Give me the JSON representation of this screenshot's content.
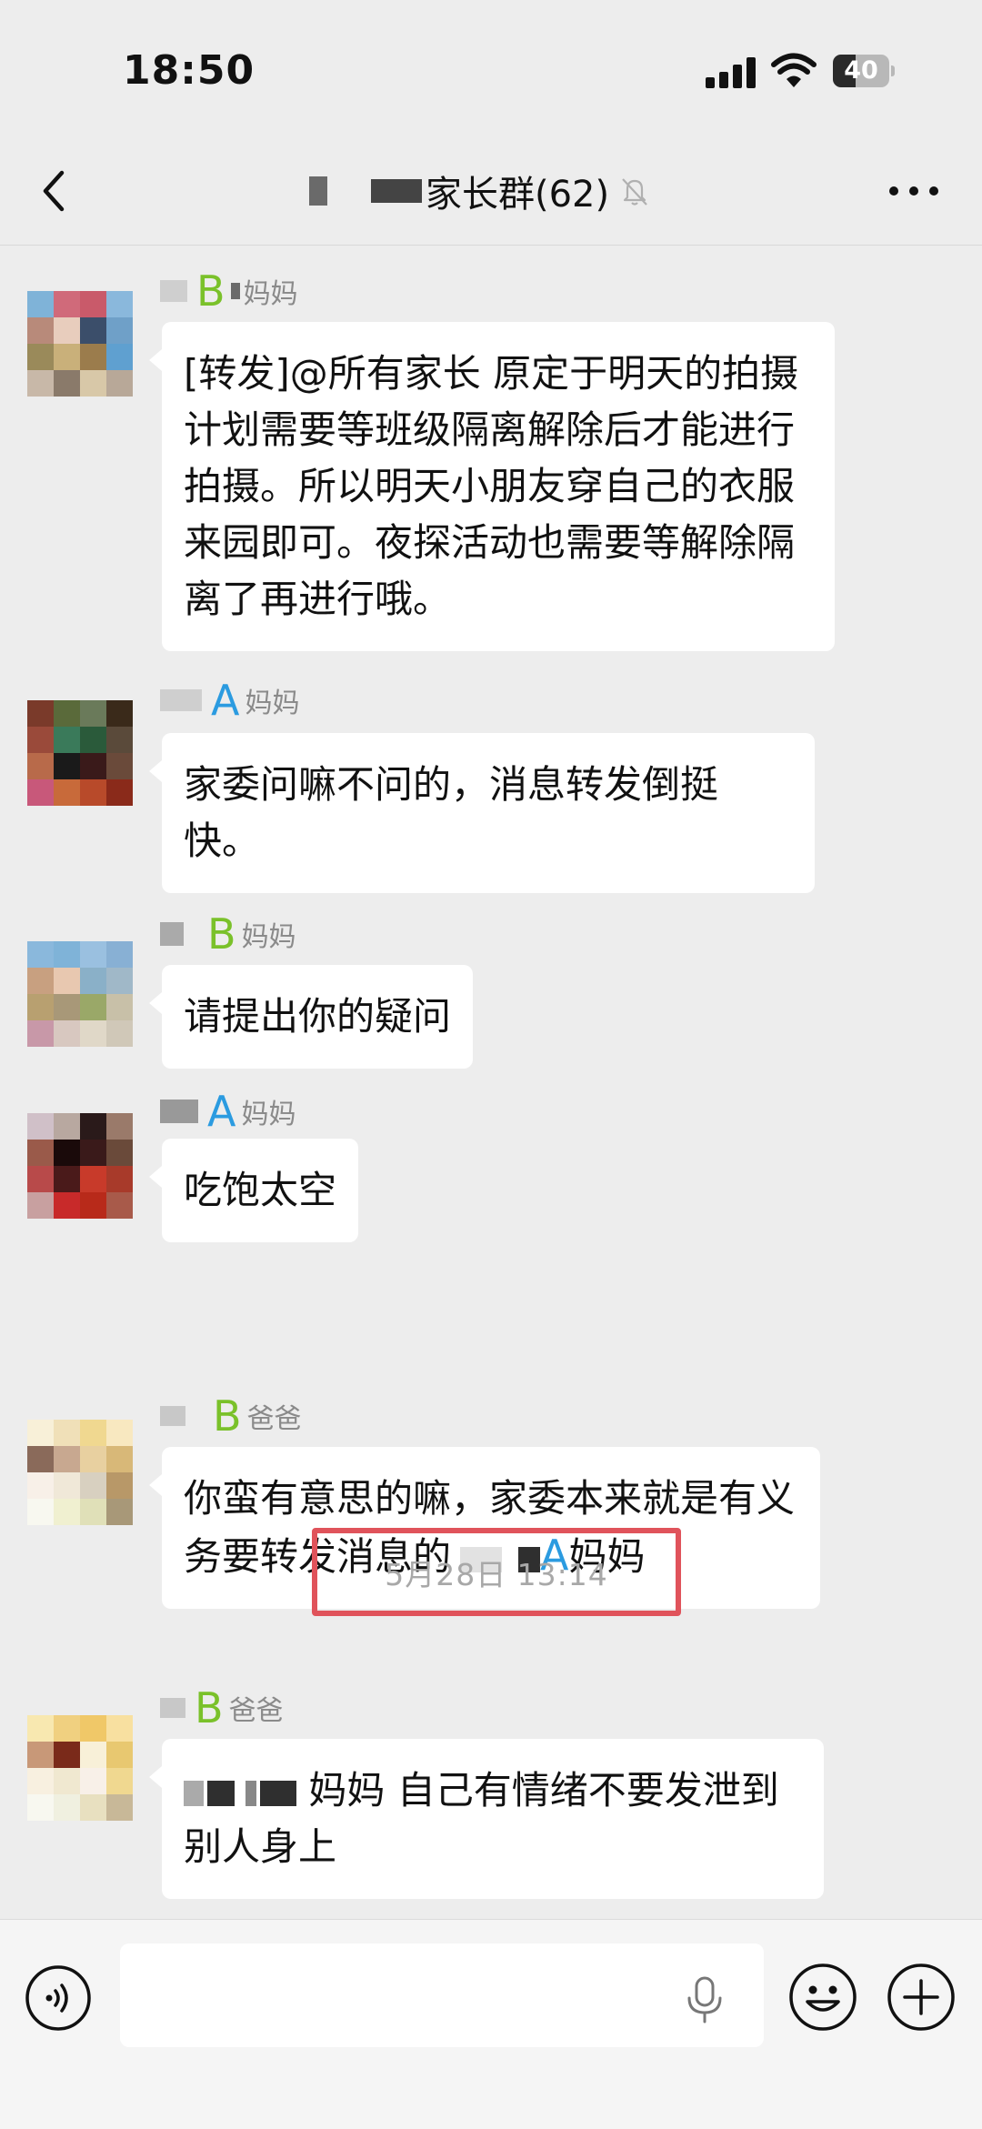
{
  "status_bar": {
    "time": "18:50",
    "battery_level": "40",
    "battery_fraction": 0.4
  },
  "nav": {
    "title": "家长群(62)",
    "back_icon": "chevron-left-icon",
    "mute_icon": "bell-off-icon",
    "more_icon": "more-dots-icon"
  },
  "messages": [
    {
      "sender_tag": "B",
      "sender_suffix": "妈妈",
      "text": "[转发]@所有家长 原定于明天的拍摄计划需要等班级隔离解除后才能进行拍摄。所以明天小朋友穿自己的衣服来园即可。夜探活动也需要等解除隔离了再进行哦。"
    },
    {
      "sender_tag": "A",
      "sender_suffix": "妈妈",
      "text": "家委问嘛不问的，消息转发倒挺快。"
    },
    {
      "sender_tag": "B",
      "sender_suffix": "妈妈",
      "text": "请提出你的疑问"
    },
    {
      "sender_tag": "A",
      "sender_suffix": "妈妈",
      "text": "吃饱太空"
    },
    {
      "sender_tag": "B",
      "sender_suffix": "爸爸",
      "text_before": "你蛮有意思的嘛，家委本来就是有义务要转发消息的",
      "text_tag": "A",
      "text_after": "妈妈"
    },
    {
      "sender_tag": "B",
      "sender_suffix": "爸爸",
      "text_rest": "妈妈 自己有情绪不要发泄到别人身上"
    }
  ],
  "timestamp": "5月28日 13:14",
  "input_bar": {
    "voice_icon": "voice-icon",
    "mic_icon": "microphone-icon",
    "emoji_icon": "emoji-icon",
    "plus_icon": "plus-icon",
    "input_value": ""
  }
}
